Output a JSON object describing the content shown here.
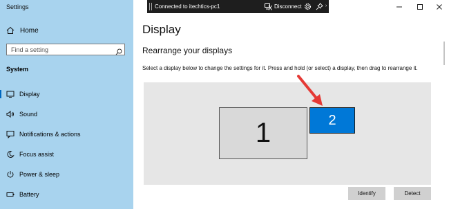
{
  "app": {
    "title": "Settings"
  },
  "sidebar": {
    "home_label": "Home",
    "search_placeholder": "Find a setting",
    "section_label": "System",
    "items": [
      {
        "label": "Display",
        "icon": "monitor-icon",
        "active": true
      },
      {
        "label": "Sound",
        "icon": "speaker-icon"
      },
      {
        "label": "Notifications & actions",
        "icon": "notifications-icon"
      },
      {
        "label": "Focus assist",
        "icon": "moon-icon"
      },
      {
        "label": "Power & sleep",
        "icon": "power-icon"
      },
      {
        "label": "Battery",
        "icon": "battery-icon"
      }
    ]
  },
  "remote_bar": {
    "connection": "Connected to itechtics-pc1",
    "disconnect": "Disconnect"
  },
  "main": {
    "title": "Display",
    "section_heading": "Rearrange your displays",
    "description": "Select a display below to change the settings for it. Press and hold (or select) a display, then drag to rearrange it.",
    "displays": [
      {
        "number": "1",
        "selected": false
      },
      {
        "number": "2",
        "selected": true
      }
    ],
    "identify_label": "Identify",
    "detect_label": "Detect"
  },
  "colors": {
    "sidebar_bg": "#a8d3ee",
    "accent": "#0078d7",
    "arrow": "#e53935"
  }
}
